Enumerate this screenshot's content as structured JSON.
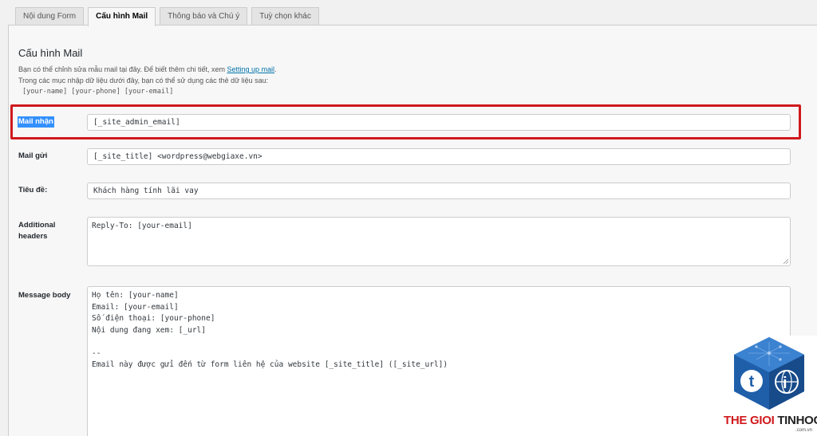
{
  "tabs": [
    {
      "label": "Nội dung Form",
      "active": false
    },
    {
      "label": "Cấu hình Mail",
      "active": true
    },
    {
      "label": "Thông báo và Chú ý",
      "active": false
    },
    {
      "label": "Tuỳ chọn khác",
      "active": false
    }
  ],
  "section": {
    "title": "Cấu hình Mail",
    "desc_line1": "Bạn có thể chỉnh sửa mẫu mail tại đây. Để biết thêm chi tiết, xem ",
    "desc_link": "Setting up mail",
    "desc_line1_end": ".",
    "desc_line2": "Trong các mục nhập dữ liệu dưới đây, bạn có thể sử dụng các thẻ dữ liệu sau:",
    "tags": "[your-name] [your-phone] [your-email]"
  },
  "fields": {
    "mail_to": {
      "label": "Mail nhận",
      "value": "[_site_admin_email]"
    },
    "mail_from": {
      "label": "Mail gửi",
      "value": "[_site_title] <wordpress@webgiaxe.vn>"
    },
    "subject": {
      "label": "Tiêu đề:",
      "value": "Khách hàng tính lãi vay"
    },
    "headers": {
      "label": "Additional headers",
      "value": "Reply-To: [your-email]"
    },
    "body": {
      "label": "Message body",
      "value": "Họ tên: [your-name]\nEmail: [your-email]\nSố điện thoại: [your-phone]\nNội dung đang xem: [_url]\n\n--\nEmail này được gửi đến từ form liên hệ của website [_site_title] ([_site_url])"
    }
  },
  "watermark": {
    "part1": "THE GIOI ",
    "part2": "TINHOC",
    "sub": ".com.vn",
    "icon": "cube-logo-icon"
  },
  "colors": {
    "accent": "#0073aa",
    "highlight": "#3390ff",
    "annotation": "#d0191c",
    "logo_blue": "#1f5faa"
  }
}
